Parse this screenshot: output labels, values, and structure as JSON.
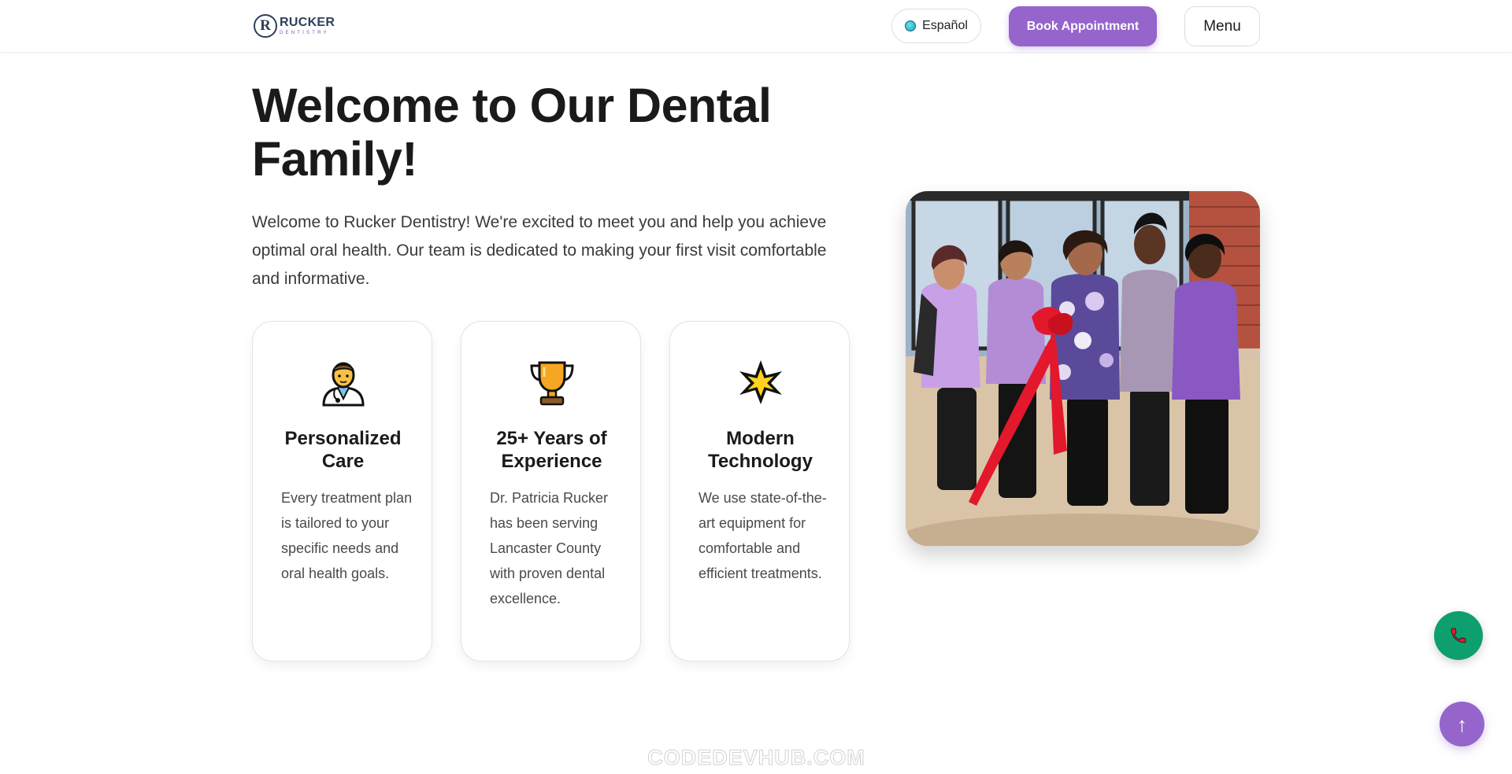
{
  "header": {
    "logo_letter": "R",
    "logo_name": "RUCKER",
    "logo_subtitle": "DENTISTRY",
    "language_label": "Español",
    "book_label": "Book Appointment",
    "menu_label": "Menu"
  },
  "hero": {
    "title": "Welcome to Our Dental Family!",
    "intro": "Welcome to Rucker Dentistry! We're excited to meet you and help you achieve optimal oral health. Our team is dedicated to making your first visit comfortable and informative."
  },
  "features": [
    {
      "icon": "doctor-icon",
      "title": "Personalized Care",
      "description": "Every treatment plan is tailored to your specific needs and oral health goals."
    },
    {
      "icon": "trophy-icon",
      "title": "25+ Years of Experience",
      "description": "Dr. Patricia Rucker has been serving Lancaster County with proven dental excellence."
    },
    {
      "icon": "star-icon",
      "title": "Modern Technology",
      "description": "We use state-of-the-art equipment for comfortable and efficient treatments."
    }
  ],
  "floating": {
    "call_icon": "phone-icon",
    "top_label": "↑"
  },
  "watermark": "CODEDEVHUB.COM",
  "colors": {
    "accent": "#9565cc",
    "call_green": "#0e9f6e",
    "logo_navy": "#2c3e5c",
    "ribbon_red": "#e3182d"
  }
}
